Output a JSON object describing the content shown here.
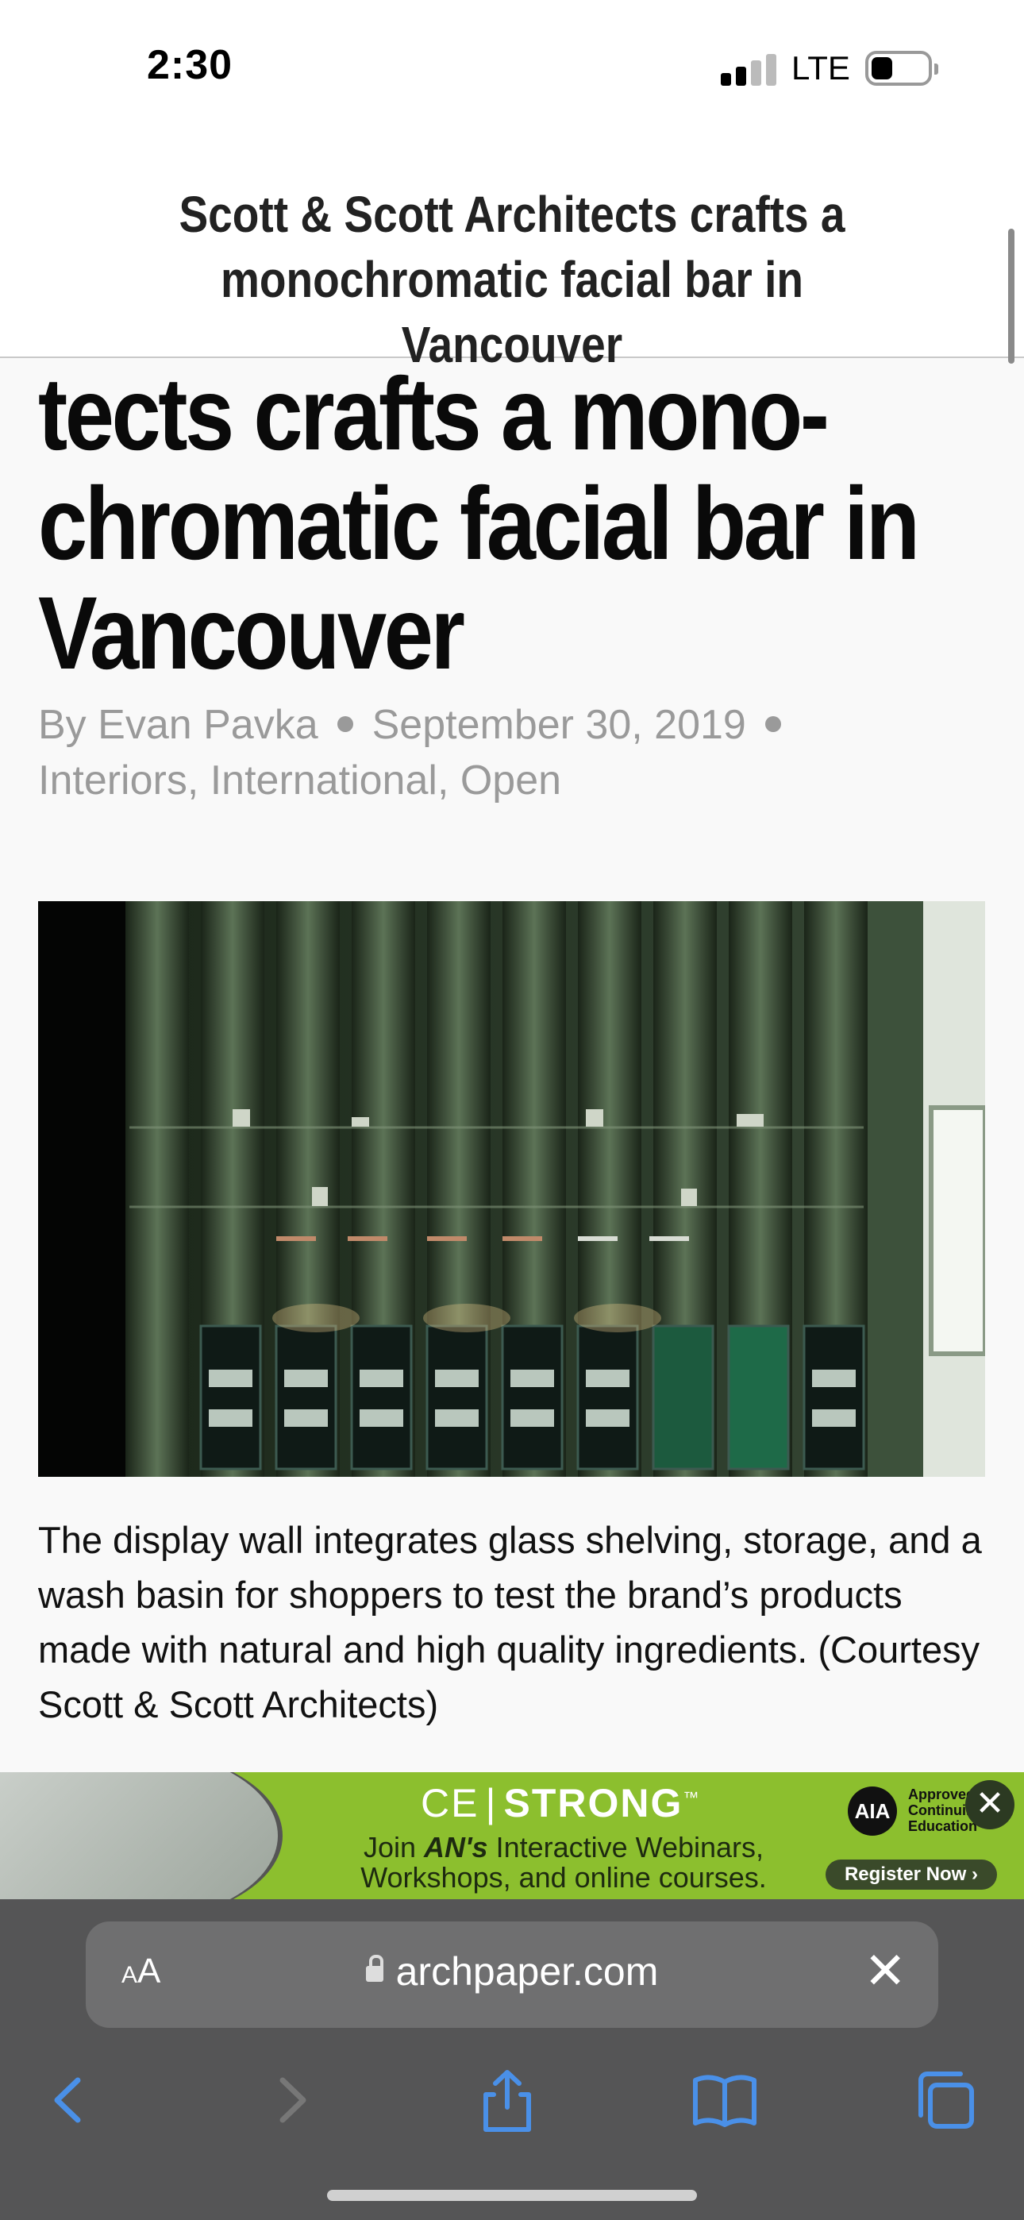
{
  "status": {
    "time": "2:30",
    "network": "LTE"
  },
  "sticky_header": {
    "title": "Scott & Scott Architects crafts a monochromatic facial bar in Vancouver"
  },
  "article": {
    "headline_lines": [
      "tects crafts a mono-",
      "chromatic facial bar in",
      "Vancouver"
    ],
    "author": "By Evan Pavka",
    "date": "September 30, 2019",
    "categories": "Interiors, International, Open",
    "caption": "The display wall integrates glass shelving, storage, and a wash basin for shoppers to test the brand’s products made with natural and high quality ingredients. (Courtesy Scott & Scott Architects)"
  },
  "ad": {
    "brand_left": "CE",
    "brand_right": "STRONG",
    "trademark": "™",
    "line1_a": "Join ",
    "line1_b": "AN's",
    "line1_c": " Interactive Webinars,",
    "line2": "Workshops, and online courses.",
    "aia_logo": "AIA",
    "aia_note": "Approved Continuing Education",
    "register": "Register Now",
    "close": "✕"
  },
  "browser": {
    "text_size_small": "A",
    "text_size_large": "A",
    "url": "archpaper.com",
    "clear": "✕"
  },
  "colors": {
    "ad_green": "#8cbf2e",
    "toolbar": "#555556",
    "link_blue": "#2f7fe0"
  }
}
